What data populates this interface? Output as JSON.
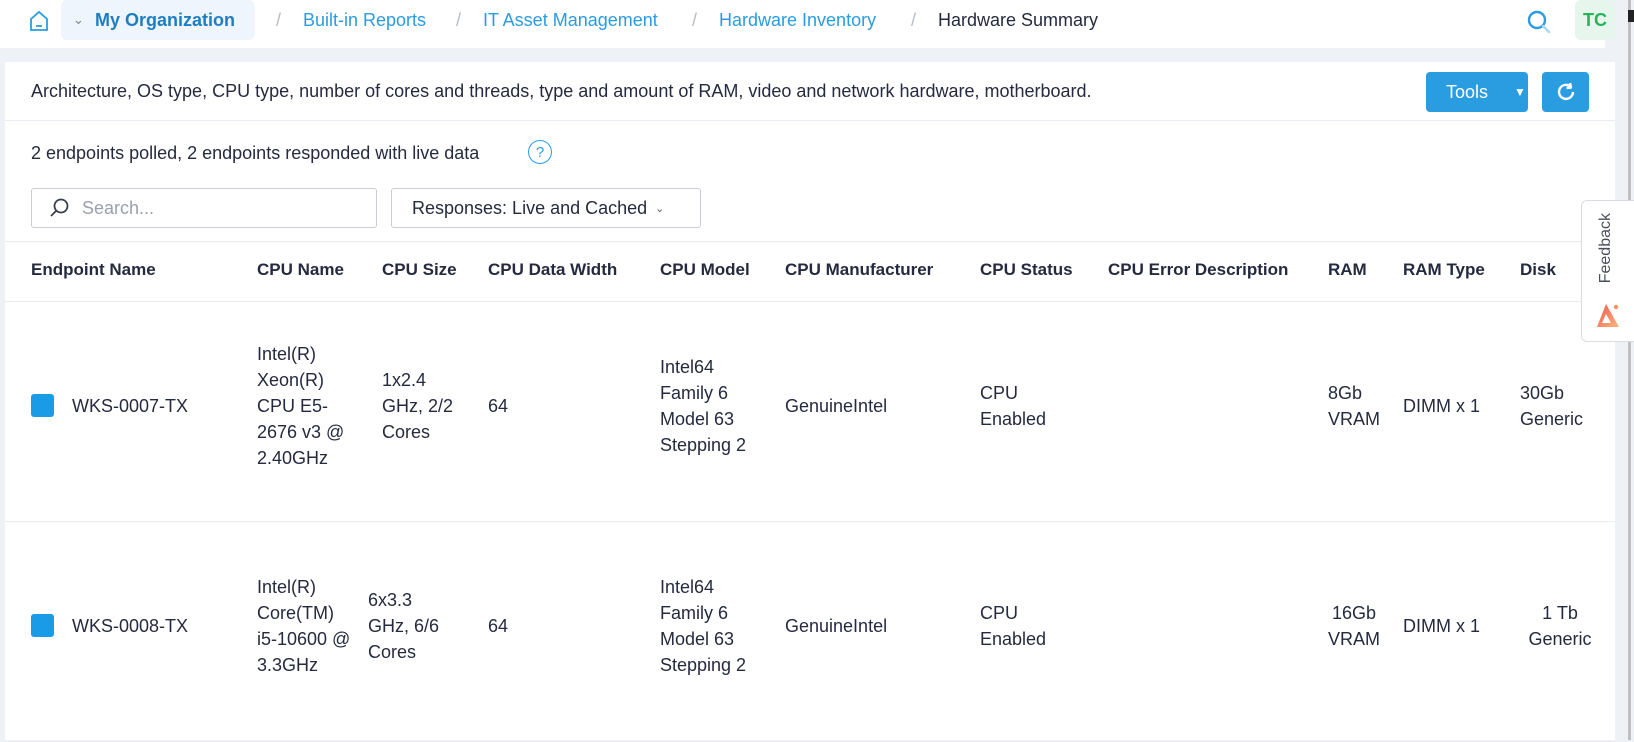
{
  "topbar": {
    "home_icon": "home-icon",
    "org_label": "My Organization",
    "breadcrumbs": [
      {
        "label": "Built-in Reports",
        "link": true
      },
      {
        "label": "IT Asset Management",
        "link": true
      },
      {
        "label": "Hardware Inventory",
        "link": true
      },
      {
        "label": "Hardware Summary",
        "link": false
      }
    ],
    "separator": "/",
    "search_icon": "search-icon",
    "avatar_initials": "TC"
  },
  "report": {
    "description": "Architecture, OS type, CPU type, number of cores and threads, type and amount of RAM, video and network hardware, motherboard.",
    "tools_label": "Tools",
    "refresh_icon": "refresh-icon",
    "status_text": "2 endpoints polled, 2 endpoints responded with live data",
    "help_glyph": "?",
    "search_placeholder": "Search...",
    "responses_label": "Responses: Live and Cached"
  },
  "table": {
    "columns": [
      "Endpoint Name",
      "CPU Name",
      "CPU Size",
      "CPU Data Width",
      "CPU Model",
      "CPU Manufacturer",
      "CPU Status",
      "CPU Error Description",
      "RAM",
      "RAM Type",
      "Disk"
    ],
    "rows": [
      {
        "endpoint": "WKS-0007-TX",
        "cpu_name": "Intel(R) Xeon(R) CPU E5-2676 v3 @ 2.40GHz",
        "cpu_size": "1x2.4 GHz, 2/2 Cores",
        "data_width": "64",
        "cpu_model": "Intel64 Family 6 Model 63 Stepping 2",
        "manufacturer": "GenuineIntel",
        "status": "CPU Enabled",
        "error": "",
        "ram": "8Gb VRAM",
        "ram_type": "DIMM x 1",
        "disk": "30Gb Generic"
      },
      {
        "endpoint": "WKS-0008-TX",
        "cpu_name": "Intel(R) Core(TM) i5-10600 @ 3.3GHz",
        "cpu_size": "6x3.3 GHz, 6/6 Cores",
        "data_width": "64",
        "cpu_model": "Intel64 Family 6 Model 63 Stepping 2",
        "manufacturer": "GenuineIntel",
        "status": "CPU Enabled",
        "error": "",
        "ram": "16Gb VRAM",
        "ram_type": "DIMM x 1",
        "disk": "1 Tb Generic"
      }
    ]
  },
  "feedback": {
    "label": "Feedback"
  },
  "colors": {
    "accent": "#2a9ce0",
    "avatar_text": "#25b35c",
    "checkbox": "#1a9be8"
  }
}
